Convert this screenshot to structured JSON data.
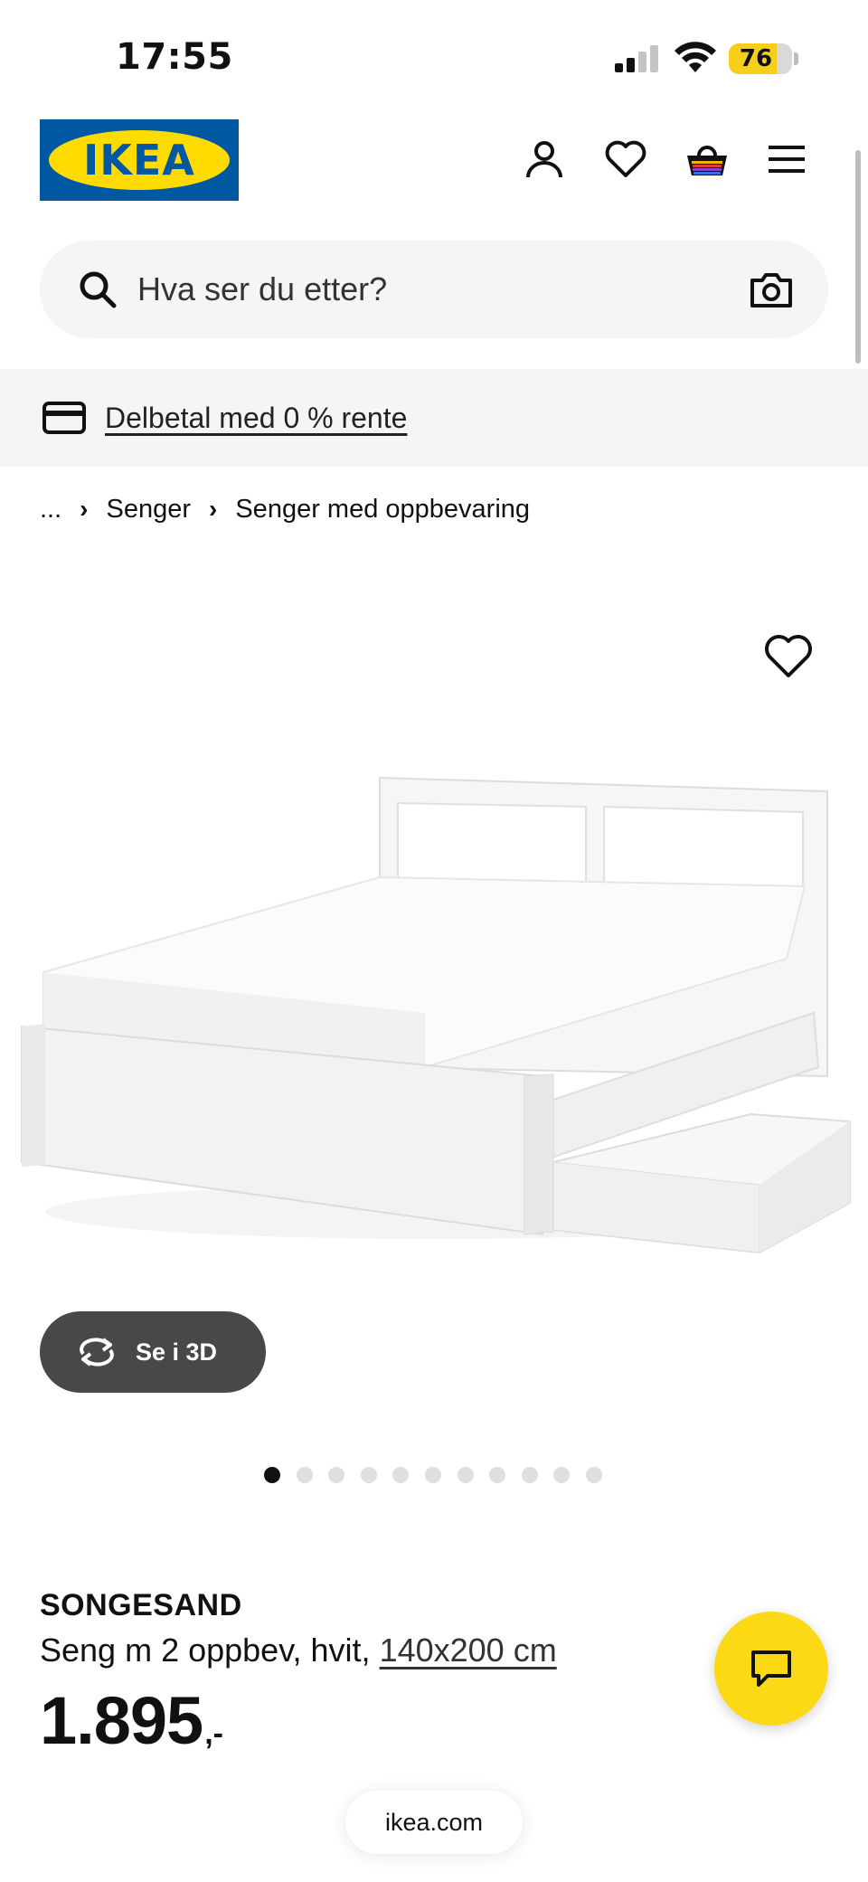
{
  "status_bar": {
    "time": "17:55",
    "battery_level": "76",
    "battery_color": "#f5cf1a",
    "signal_icon": "cellular-signal-icon",
    "wifi_icon": "wifi-icon"
  },
  "header": {
    "logo_text": "IKEA",
    "brand_colors": {
      "blue": "#0058a3",
      "yellow": "#ffdb00"
    },
    "icons": [
      "account-icon",
      "heart-icon",
      "shopping-bag-icon",
      "menu-icon"
    ]
  },
  "search": {
    "placeholder": "Hva ser du etter?",
    "value": "",
    "icons": [
      "search-icon",
      "camera-icon"
    ]
  },
  "promo": {
    "icon": "credit-card-icon",
    "text": "Delbetal med 0 % rente"
  },
  "breadcrumb": {
    "items": [
      "...",
      "Senger",
      "Senger med oppbevaring"
    ]
  },
  "product": {
    "image_alt": "SONGESAND white bed frame with 2 storage boxes",
    "favorite_icon": "heart-icon",
    "view3d_label": "Se i 3D",
    "view3d_icon": "rotate-3d-icon",
    "carousel": {
      "count": 11,
      "active_index": 0
    },
    "name": "SONGESAND",
    "description": "Seng m 2 oppbev, hvit,",
    "size": "140x200 cm",
    "price": "1.895",
    "price_suffix": ",-"
  },
  "chat": {
    "icon": "chat-bubble-icon",
    "color": "#fbd914"
  },
  "browser": {
    "url": "ikea.com"
  }
}
